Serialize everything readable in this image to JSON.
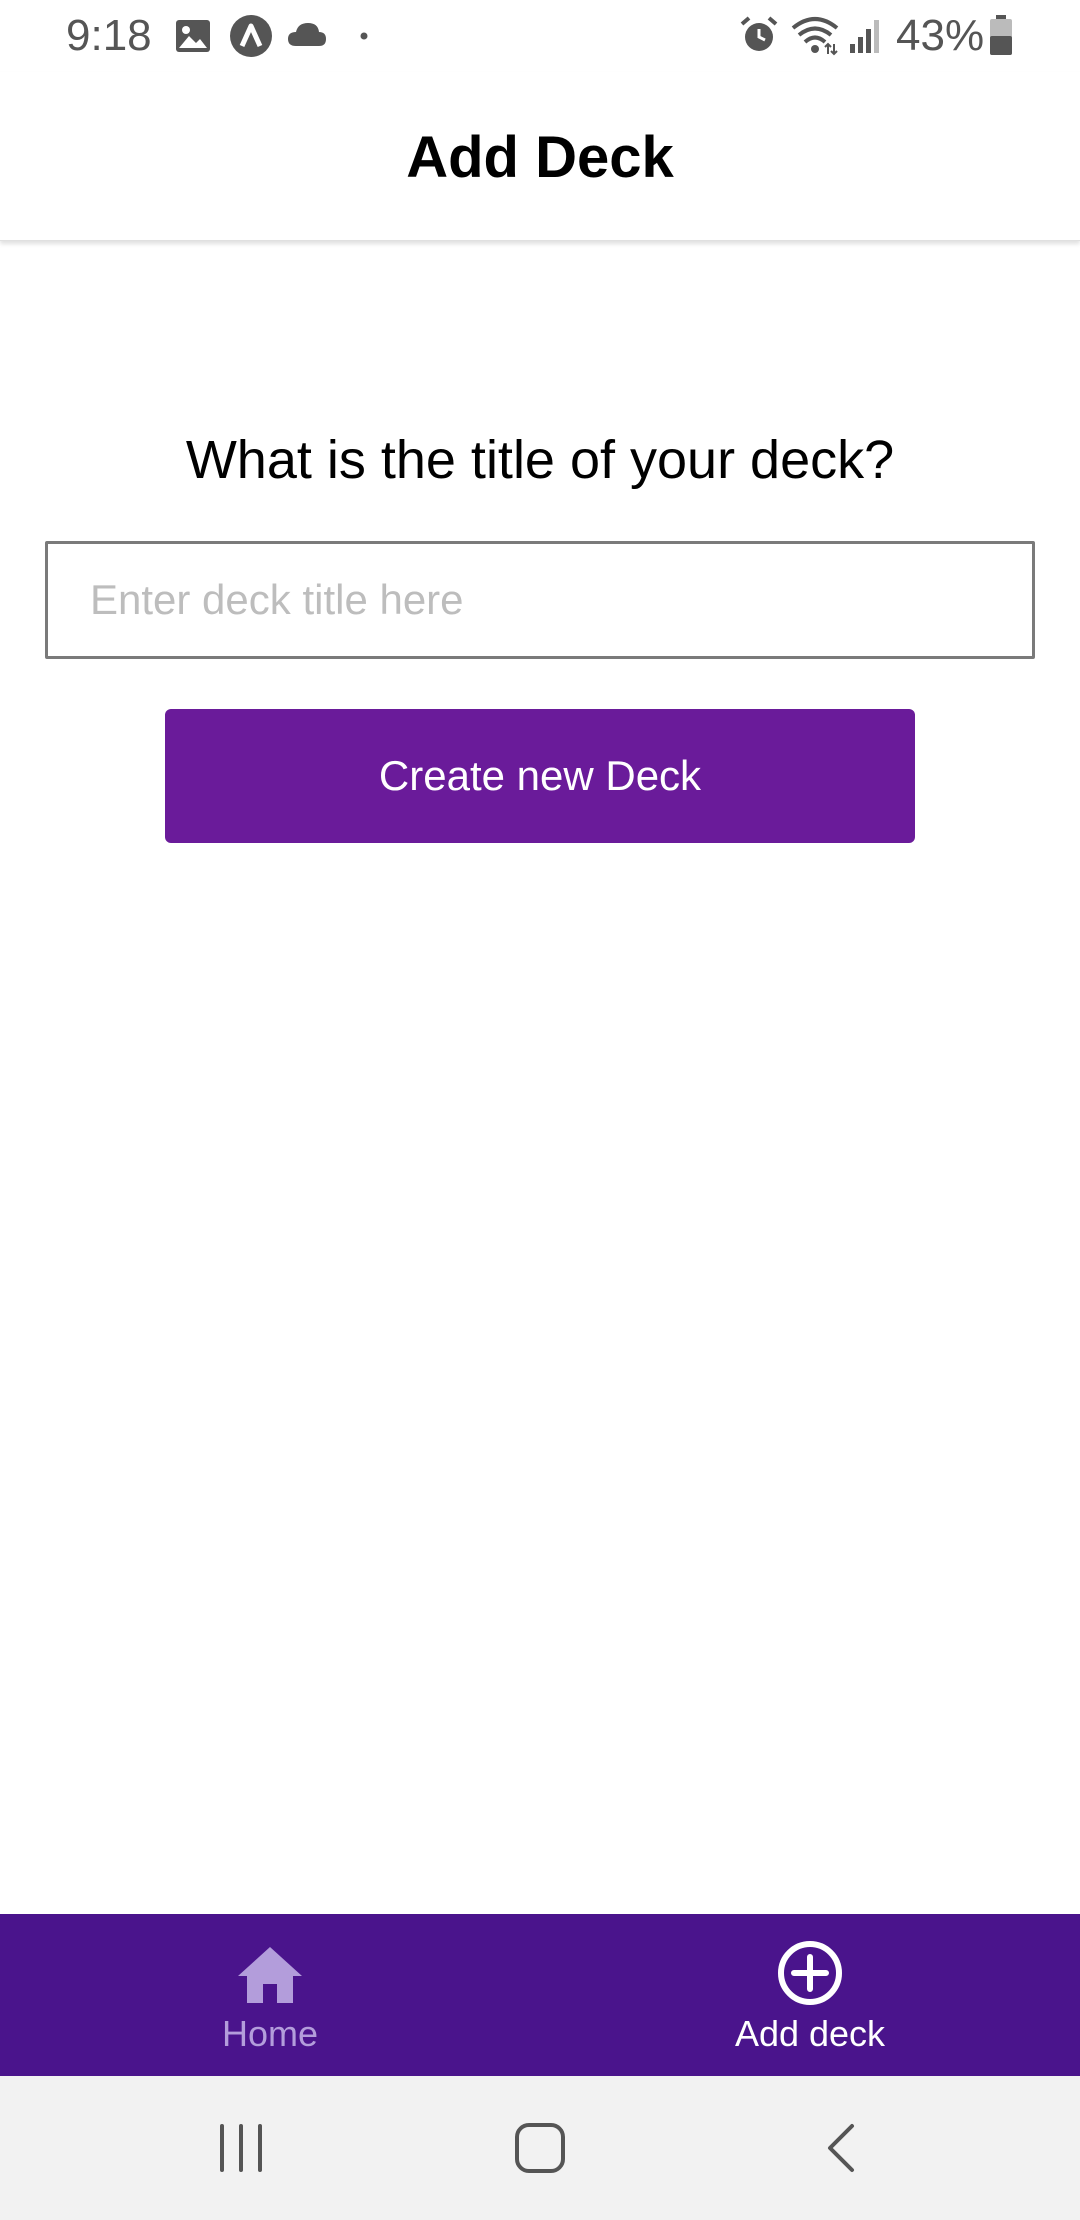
{
  "status_bar": {
    "time": "9:18",
    "battery": "43%",
    "icons": [
      "image-icon",
      "app-notification-icon",
      "cloud-icon",
      "dot-icon",
      "alarm-icon",
      "wifi-icon",
      "signal-icon",
      "battery-icon"
    ]
  },
  "header": {
    "title": "Add Deck"
  },
  "form": {
    "question": "What is the title of your deck?",
    "input_placeholder": "Enter deck title here",
    "input_value": "",
    "submit_label": "Create new Deck"
  },
  "tabs": [
    {
      "label": "Home",
      "icon": "home-icon",
      "active": false
    },
    {
      "label": "Add deck",
      "icon": "add-circle-icon",
      "active": true
    }
  ],
  "system_nav": {
    "icons": [
      "recent-apps-icon",
      "home-nav-icon",
      "back-icon"
    ]
  },
  "colors": {
    "primary": "#6a1b9a",
    "tab_bar": "#4a148c",
    "inactive_tab": "#b39ddb",
    "active_tab": "#ffffff"
  }
}
